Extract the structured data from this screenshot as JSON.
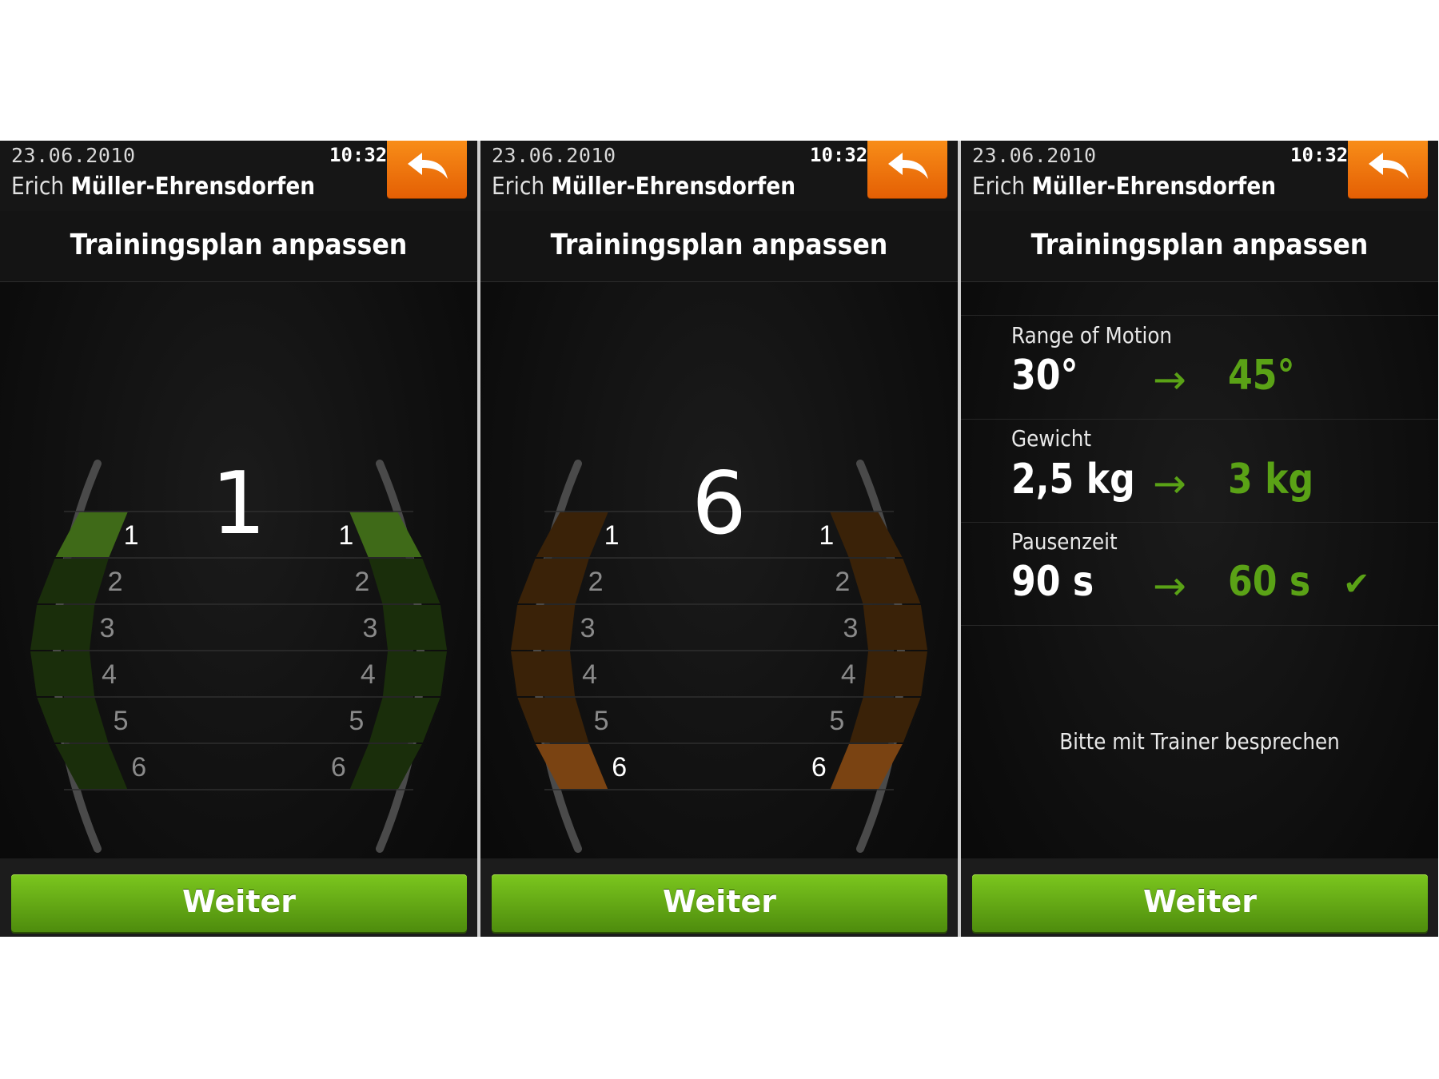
{
  "header": {
    "date": "23.06.2010",
    "time": "10:32",
    "user_first": "Erich",
    "user_last": "Müller-Ehrensdorfen"
  },
  "title": "Trainingsplan anpassen",
  "next_label": "Weiter",
  "accent_colors": {
    "green": "#5aa216",
    "orange": "#e8740a",
    "back_button": "#f07a10"
  },
  "screens": [
    {
      "type": "level-picker",
      "scale": [
        "1",
        "2",
        "3",
        "4",
        "5",
        "6"
      ],
      "selected": "1",
      "highlight": "green"
    },
    {
      "type": "level-picker",
      "scale": [
        "1",
        "2",
        "3",
        "4",
        "5",
        "6"
      ],
      "selected": "6",
      "highlight": "orange"
    },
    {
      "type": "summary",
      "items": [
        {
          "label": "Range of Motion",
          "old": "30°",
          "arrow": "→",
          "new": "45°",
          "confirmed": false
        },
        {
          "label": "Gewicht",
          "old": "2,5 kg",
          "arrow": "→",
          "new": "3 kg",
          "confirmed": false
        },
        {
          "label": "Pausenzeit",
          "old": "90 s",
          "arrow": "→",
          "new": "60 s",
          "confirmed": true
        }
      ],
      "note": "Bitte mit Trainer besprechen"
    }
  ]
}
